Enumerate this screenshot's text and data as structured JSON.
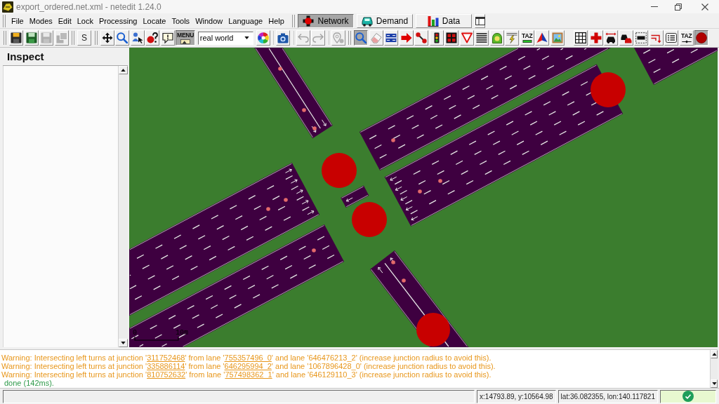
{
  "window": {
    "title": "export_ordered.net.xml - netedit 1.24.0"
  },
  "menu": [
    "File",
    "Modes",
    "Edit",
    "Lock",
    "Processing",
    "Locate",
    "Tools",
    "Window",
    "Language",
    "Help"
  ],
  "supermodes": [
    {
      "label": "Network",
      "selected": true
    },
    {
      "label": "Demand",
      "selected": false
    },
    {
      "label": "Data",
      "selected": false
    }
  ],
  "toolbar": {
    "file": [
      {
        "disabled": false
      },
      {
        "disabled": false
      },
      {
        "disabled": true
      },
      {
        "disabled": true
      }
    ],
    "sumo": {
      "label": "S"
    },
    "navigation": [
      {
        "on": false
      },
      {
        "on": false
      },
      {
        "on": false
      },
      {
        "on": false
      },
      {
        "on": false
      },
      {
        "label": "MENU",
        "on": true
      }
    ],
    "view_scheme": {
      "value": "real world"
    },
    "edit": [
      {
        "disabled": false
      },
      {
        "disabled": false
      },
      {
        "disabled": true
      },
      {
        "disabled": true
      },
      {
        "disabled": true
      }
    ],
    "modes": [
      {
        "selected": true
      },
      {
        "selected": false
      },
      {
        "selected": false
      },
      {
        "selected": false
      },
      {
        "selected": false
      },
      {
        "selected": false
      },
      {
        "selected": false
      },
      {
        "selected": false
      },
      {
        "selected": false
      },
      {
        "selected": false
      },
      {
        "selected": false
      },
      {
        "label": "TAZ",
        "selected": false
      },
      {
        "selected": false
      },
      {
        "selected": false
      }
    ],
    "mode_options": [
      {
        "on": false
      },
      {
        "on": false
      },
      {
        "on": false
      },
      {
        "on": false
      },
      {
        "on": false
      },
      {
        "on": false
      },
      {
        "on": false
      },
      {
        "label": "TAZ",
        "on": false
      },
      {
        "on": true
      }
    ]
  },
  "inspector": {
    "title": "Inspect"
  },
  "canvas": {
    "scale_bar": {
      "start_label": "0",
      "end_label": "10m"
    }
  },
  "messages": [
    {
      "kind": "warning",
      "parts": [
        {
          "text": "Warning: Intersecting left turns at junction '",
          "link": false
        },
        {
          "text": "311752468",
          "link": true
        },
        {
          "text": "' from lane '",
          "link": false
        },
        {
          "text": "755357496_0",
          "link": true
        },
        {
          "text": "' and lane '646476213_2' (increase junction radius to avoid this).",
          "link": false
        }
      ]
    },
    {
      "kind": "warning",
      "parts": [
        {
          "text": "Warning: Intersecting left turns at junction '",
          "link": false
        },
        {
          "text": "335886114",
          "link": true
        },
        {
          "text": "' from lane '",
          "link": false
        },
        {
          "text": "646295994_2",
          "link": true
        },
        {
          "text": "' and lane '1067896428_0' (increase junction radius to avoid this).",
          "link": false
        }
      ]
    },
    {
      "kind": "warning",
      "parts": [
        {
          "text": "Warning: Intersecting left turns at junction '",
          "link": false
        },
        {
          "text": "810752632",
          "link": true
        },
        {
          "text": "' from lane '",
          "link": false
        },
        {
          "text": "757498362_1",
          "link": true
        },
        {
          "text": "' and lane '646129110_3' (increase junction radius to avoid this).",
          "link": false
        }
      ]
    },
    {
      "kind": "info",
      "parts": [
        {
          "text": "done (142ms).",
          "link": false
        }
      ]
    }
  ],
  "status_bar": {
    "coordinates": "x:14793.89, y:10564.98",
    "geo_coordinates": "lat:36.082355, lon:140.117821",
    "ok": true
  }
}
